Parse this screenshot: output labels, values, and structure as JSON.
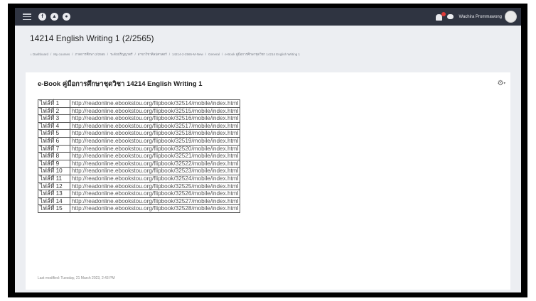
{
  "navbar": {
    "nav_icons": [
      {
        "icon": "facebook-icon",
        "glyph": "f"
      },
      {
        "icon": "app-icon",
        "glyph": "▲"
      },
      {
        "icon": "line-icon",
        "glyph": "●"
      }
    ],
    "user_name": "Wachira Prommawong"
  },
  "page": {
    "title": "14214 English Writing 1 (2/2565)",
    "breadcrumb": [
      "Dashboard",
      "My courses",
      "ภาคการศึกษา 2/2565",
      "ระดับปริญญาตรี",
      "สาขาวิชาศิลปศาสตร์",
      "14214-2-2565-M-New",
      "General",
      "e-Book คู่มือการศึกษาชุดวิชา 14214 English Writing 1"
    ]
  },
  "card": {
    "title": "e-Book คู่มือการศึกษาชุดวิชา 14214 English Writing 1",
    "rows": [
      {
        "label": "ไฟล์ที่ 1",
        "url": "http://readonline.ebookstou.org/flipbook/32514/mobile/index.html"
      },
      {
        "label": "ไฟล์ที่ 2",
        "url": "http://readonline.ebookstou.org/flipbook/32515/mobile/index.html"
      },
      {
        "label": "ไฟล์ที่ 3",
        "url": "http://readonline.ebookstou.org/flipbook/32516/mobile/index.html"
      },
      {
        "label": "ไฟล์ที่ 4",
        "url": "http://readonline.ebookstou.org/flipbook/32517/mobile/index.html"
      },
      {
        "label": "ไฟล์ที่ 5",
        "url": "http://readonline.ebookstou.org/flipbook/32518/mobile/index.html"
      },
      {
        "label": "ไฟล์ที่ 6",
        "url": "http://readonline.ebookstou.org/flipbook/32519/mobile/index.html"
      },
      {
        "label": "ไฟล์ที่ 7",
        "url": "http://readonline.ebookstou.org/flipbook/32520/mobile/index.html"
      },
      {
        "label": "ไฟล์ที่ 8",
        "url": "http://readonline.ebookstou.org/flipbook/32521/mobile/index.html"
      },
      {
        "label": "ไฟล์ที่ 9",
        "url": "http://readonline.ebookstou.org/flipbook/32522/mobile/index.html"
      },
      {
        "label": "ไฟล์ที่ 10",
        "url": "http://readonline.ebookstou.org/flipbook/32523/mobile/index.html"
      },
      {
        "label": "ไฟล์ที่ 11",
        "url": "http://readonline.ebookstou.org/flipbook/32524/mobile/index.html"
      },
      {
        "label": "ไฟล์ที่ 12",
        "url": "http://readonline.ebookstou.org/flipbook/32525/mobile/index.html"
      },
      {
        "label": "ไฟล์ที่ 13",
        "url": "http://readonline.ebookstou.org/flipbook/32526/mobile/index.html"
      },
      {
        "label": "ไฟล์ที่ 14",
        "url": "http://readonline.ebookstou.org/flipbook/32527/mobile/index.html"
      },
      {
        "label": "ไฟล์ที่ 15",
        "url": "http://readonline.ebookstou.org/flipbook/32528/mobile/index.html"
      }
    ],
    "last_modified": "Last modified: Tuesday, 21 March 2023, 2:43 PM"
  },
  "colors": {
    "navbar_bg": "#2f3441",
    "content_bg": "#eceef2",
    "notification_badge": "#e03a3a"
  }
}
